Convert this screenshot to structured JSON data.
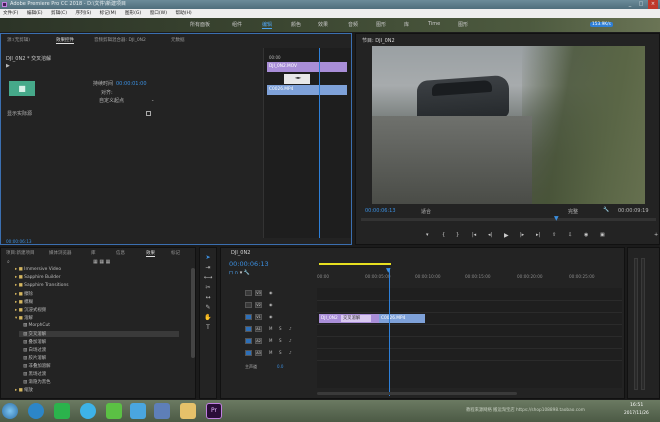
{
  "app": {
    "title": "Adobe Premiere Pro CC 2018 - D:\\文件\\新建项目",
    "window_controls": [
      "_",
      "□",
      "×"
    ]
  },
  "menu": [
    "文件(F)",
    "编辑(E)",
    "剪辑(C)",
    "序列(S)",
    "标记(M)",
    "图形(G)",
    "窗口(W)",
    "帮助(H)"
  ],
  "workspaces": [
    {
      "label": "所有面板",
      "active": false
    },
    {
      "label": "组件",
      "active": false
    },
    {
      "label": "编辑",
      "active": true
    },
    {
      "label": "颜色",
      "active": false
    },
    {
      "label": "效果",
      "active": false
    },
    {
      "label": "音频",
      "active": false
    },
    {
      "label": "图形",
      "active": false
    },
    {
      "label": "库",
      "active": false
    },
    {
      "label": "Time",
      "active": false
    },
    {
      "label": "图形",
      "active": false
    }
  ],
  "badge": "153.9K/s",
  "effect_controls": {
    "tabs": [
      "源:(无剪辑)",
      "效果控件",
      "音频剪辑混合器: DJI_0N2",
      "元数据"
    ],
    "clip_label": "DJI_0N2 * 交叉溶解",
    "duration_label": "持续时间",
    "duration_value": "00:00:01:00",
    "alignment_label": "对齐:",
    "alignment_value": "自定义起点",
    "reverse_label": "显示实际源",
    "mini_timeline": {
      "ruler_start": "00:00",
      "clip_a": "DJI_0N2.MOV",
      "clip_b": "C0026.MP4",
      "transition_mark": "◄►"
    },
    "timecode": "00:00:06:13"
  },
  "program_monitor": {
    "title": "节目: DJI_0N2",
    "timecode_current": "00:00:06:13",
    "fit_label": "适合",
    "quality_label": "完整",
    "timecode_total": "00:00:09:19"
  },
  "project": {
    "tabs": [
      "项目:新建项目",
      "媒体浏览器",
      "库",
      "信息",
      "效果",
      "标记"
    ],
    "items": [
      {
        "label": "Immersive Video",
        "type": "folder"
      },
      {
        "label": "Sapphire Builder",
        "type": "folder"
      },
      {
        "label": "Sapphire Transitions",
        "type": "folder"
      },
      {
        "label": "擦除",
        "type": "folder"
      },
      {
        "label": "模糊",
        "type": "folder"
      },
      {
        "label": "沉浸式视频",
        "type": "folder"
      },
      {
        "label": "溶解",
        "type": "folder"
      },
      {
        "label": "MorphCut",
        "type": "effect"
      },
      {
        "label": "交叉溶解",
        "type": "effect",
        "selected": true
      },
      {
        "label": "叠加溶解",
        "type": "effect"
      },
      {
        "label": "白场过渡",
        "type": "effect"
      },
      {
        "label": "胶片溶解",
        "type": "effect"
      },
      {
        "label": "非叠加溶解",
        "type": "effect"
      },
      {
        "label": "黑场过渡",
        "type": "effect"
      },
      {
        "label": "渐隐为黑色",
        "type": "effect"
      },
      {
        "label": "缩放",
        "type": "folder"
      }
    ]
  },
  "timeline": {
    "tab": "DJI_0N2",
    "timecode": "00:00:06:13",
    "ruler": [
      "00:00",
      "00:00:05:00",
      "00:00:10:00",
      "00:00:15:00",
      "00:00:20:00",
      "00:00:25:00"
    ],
    "tracks": [
      "V3",
      "V2",
      "V1",
      "A1",
      "A2",
      "A3"
    ],
    "master_label": "主声道",
    "master_value": "0.0",
    "clip_v1_a": "DJI_0N2",
    "transition_label": "交叉溶解",
    "clip_v1_b": "C0026.MP4"
  },
  "taskbar": {
    "watermark": "教程来源网络 搬运淘宝店 https://shop108898.taobao.com",
    "time": "16:51",
    "date": "2017/11/26"
  },
  "colors": {
    "accent": "#3b8fe0",
    "clip_a": "#a98ed8",
    "clip_b": "#7ea1d9",
    "playhead": "#2d7fd8"
  }
}
